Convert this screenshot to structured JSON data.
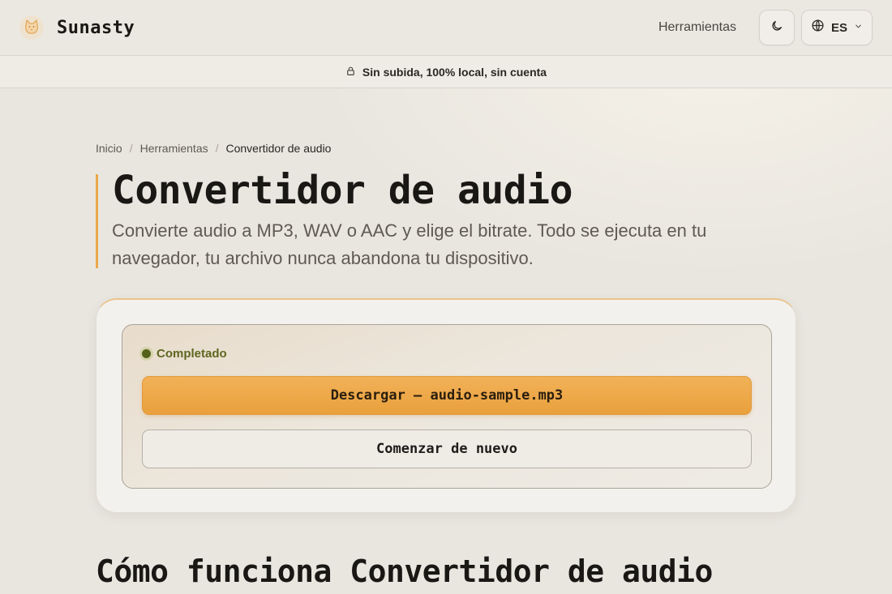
{
  "header": {
    "brand_name": "Sunasty",
    "logo_icon": "cat-logo-icon",
    "nav_tools_label": "Herramientas",
    "theme_icon": "moon-icon",
    "lang_icon": "globe-icon",
    "lang_label": "ES",
    "lang_chevron_icon": "chevron-down-icon"
  },
  "notice": {
    "icon": "lock-icon",
    "text": "Sin subida, 100% local, sin cuenta"
  },
  "breadcrumb": {
    "home": "Inicio",
    "separator": "/",
    "tools": "Herramientas",
    "current": "Convertidor de audio"
  },
  "hero": {
    "title": "Convertidor de audio",
    "description": "Convierte audio a MP3, WAV o AAC y elige el bitrate. Todo se ejecuta en tu navegador, tu archivo nunca abandona tu dispositivo."
  },
  "converter": {
    "status_label": "Completado",
    "download_label": "Descargar — audio-sample.mp3",
    "restart_label": "Comenzar de nuevo"
  },
  "how_it_works": {
    "heading": "Cómo funciona Convertidor de audio"
  },
  "colors": {
    "accent": "#e9a03c",
    "background": "#e9e6e0",
    "status_green": "#55601b"
  }
}
